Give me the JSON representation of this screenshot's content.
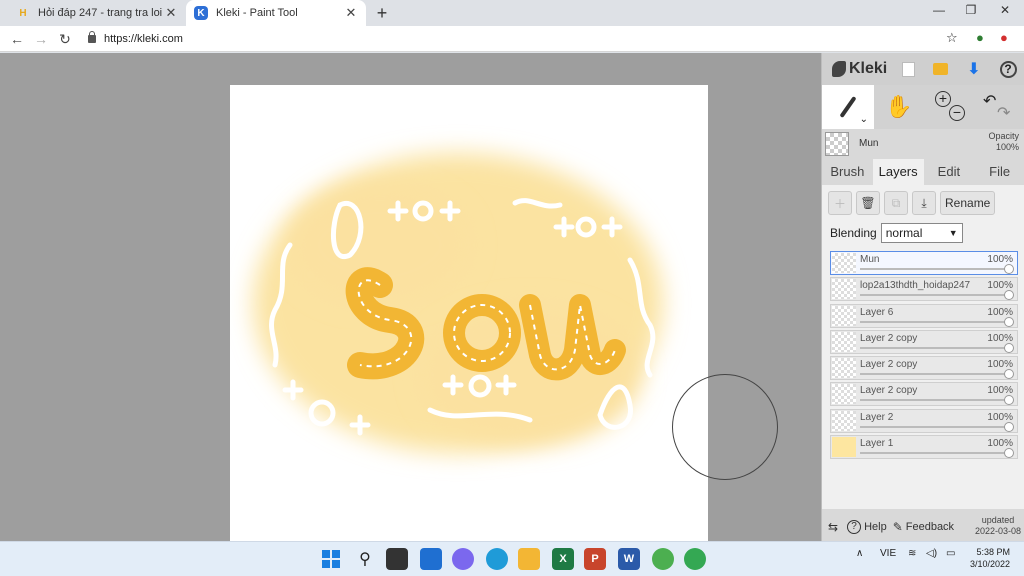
{
  "browser": {
    "tabs": [
      {
        "title": "Hỏi đáp 247 - trang tra loi",
        "favicon": "H"
      },
      {
        "title": "Kleki - Paint Tool",
        "favicon": "K"
      }
    ],
    "url": "https://kleki.com"
  },
  "app": {
    "logo_text": "Kleki",
    "current_layer": "Mun",
    "opacity_label": "Opacity",
    "opacity_value": "100%",
    "tabs": [
      "Brush",
      "Layers",
      "Edit",
      "File"
    ],
    "active_tab": "Layers",
    "rename_label": "Rename",
    "blending_label": "Blending",
    "blending_value": "normal",
    "layers": [
      {
        "name": "Mun",
        "opacity": "100%"
      },
      {
        "name": "lop2a13thdth_hoidap247",
        "opacity": "100%"
      },
      {
        "name": "Layer 6",
        "opacity": "100%"
      },
      {
        "name": "Layer 2 copy",
        "opacity": "100%"
      },
      {
        "name": "Layer 2 copy",
        "opacity": "100%"
      },
      {
        "name": "Layer 2 copy",
        "opacity": "100%"
      },
      {
        "name": "Layer 2",
        "opacity": "100%"
      },
      {
        "name": "Layer 1",
        "opacity": "100%"
      }
    ],
    "footer": {
      "help": "Help",
      "feedback": "Feedback",
      "updated_label": "updated",
      "updated_date": "2022-03-08"
    }
  },
  "taskbar": {
    "lang": "VIE",
    "time": "5:38 PM",
    "date": "3/10/2022"
  }
}
